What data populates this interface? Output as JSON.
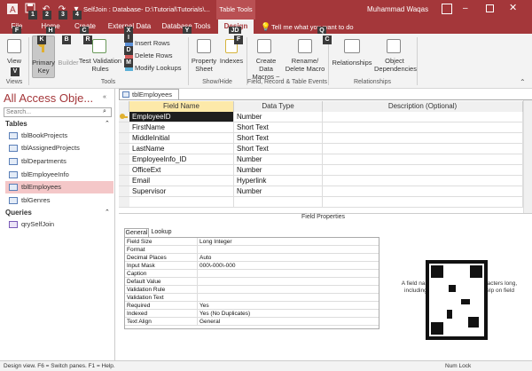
{
  "title": {
    "text": "SelfJoin : Database- D:\\Tutorial\\Tutorials\\...",
    "context_tab": "Table Tools",
    "user": "Muhammad Waqas"
  },
  "keytips": {
    "save": "1",
    "undo": "2",
    "redo": "3",
    "quick": "4",
    "file": "F",
    "home": "H",
    "create": "C",
    "external": "X",
    "dbtools": "Y",
    "design": "JD",
    "tell": "Q",
    "ribbon_m": "M",
    "ribbon_v": "V",
    "ribbon_i": "I",
    "ribbon_f": "F",
    "ribbon_k": "K",
    "ribbon_d": "D",
    "ribbon_b": "B",
    "ribbon_r": "R",
    "ribbon_c": "C"
  },
  "tabs": [
    "File",
    "Home",
    "Create",
    "External Data",
    "Database Tools",
    "Design"
  ],
  "tell_me": "Tell me what you want to do",
  "ribbon": {
    "view": "View",
    "primary_key": "Primary\nKey",
    "builder": "Builder",
    "test_validation": "Test Validation\nRules",
    "insert_rows": "Insert Rows",
    "delete_rows": "Delete Rows",
    "modify_lookups": "Modify Lookups",
    "property_sheet": "Property\nSheet",
    "indexes": "Indexes",
    "create_data_macros": "Create Data\nMacros ~",
    "rename_delete_macro": "Rename/\nDelete Macro",
    "relationships": "Relationships",
    "object_dependencies": "Object\nDependencies",
    "groups": [
      "Views",
      "Tools",
      "Show/Hide",
      "Field, Record & Table Events",
      "Relationships"
    ]
  },
  "nav": {
    "title": "All Access Obje...",
    "search_placeholder": "Search...",
    "tables_label": "Tables",
    "tables": [
      "tblBookProjects",
      "tblAssignedProjects",
      "tblDepartments",
      "tblEmployeeInfo",
      "tblEmployees",
      "tblGenres"
    ],
    "selected": "tblEmployees",
    "queries_label": "Queries",
    "queries": [
      "qrySelfJoin"
    ]
  },
  "doc_tab": "tblEmployees",
  "grid": {
    "headers": [
      "Field Name",
      "Data Type",
      "Description (Optional)"
    ],
    "rows": [
      [
        "EmployeeID",
        "Number"
      ],
      [
        "FirstName",
        "Short Text"
      ],
      [
        "MiddleInitial",
        "Short Text"
      ],
      [
        "LastName",
        "Short Text"
      ],
      [
        "EmployeeInfo_ID",
        "Number"
      ],
      [
        "OfficeExt",
        "Number"
      ],
      [
        "Email",
        "Hyperlink"
      ],
      [
        "Supervisor",
        "Number"
      ]
    ]
  },
  "field_properties": {
    "title": "Field Properties",
    "tabs": [
      "General",
      "Lookup"
    ],
    "rows": [
      [
        "Field Size",
        "Long Integer"
      ],
      [
        "Format",
        ""
      ],
      [
        "Decimal Places",
        "Auto"
      ],
      [
        "Input Mask",
        "000\\-000\\-000"
      ],
      [
        "Caption",
        ""
      ],
      [
        "Default Value",
        ""
      ],
      [
        "Validation Rule",
        ""
      ],
      [
        "Validation Text",
        ""
      ],
      [
        "Required",
        "Yes"
      ],
      [
        "Indexed",
        "Yes (No Duplicates)"
      ],
      [
        "Text Align",
        "General"
      ]
    ],
    "help_line1": "A field name can be up to 64 characters long,",
    "help_line2": "including spaces. Press F1 for help on field"
  },
  "status": {
    "left": "Design view.  F6 = Switch panes.  F1 = Help.",
    "right": "Num Lock"
  },
  "colors": {
    "accent": "#a4373a",
    "selected_nav": "#f4c7c8",
    "highlight": "#ffeb9c"
  }
}
